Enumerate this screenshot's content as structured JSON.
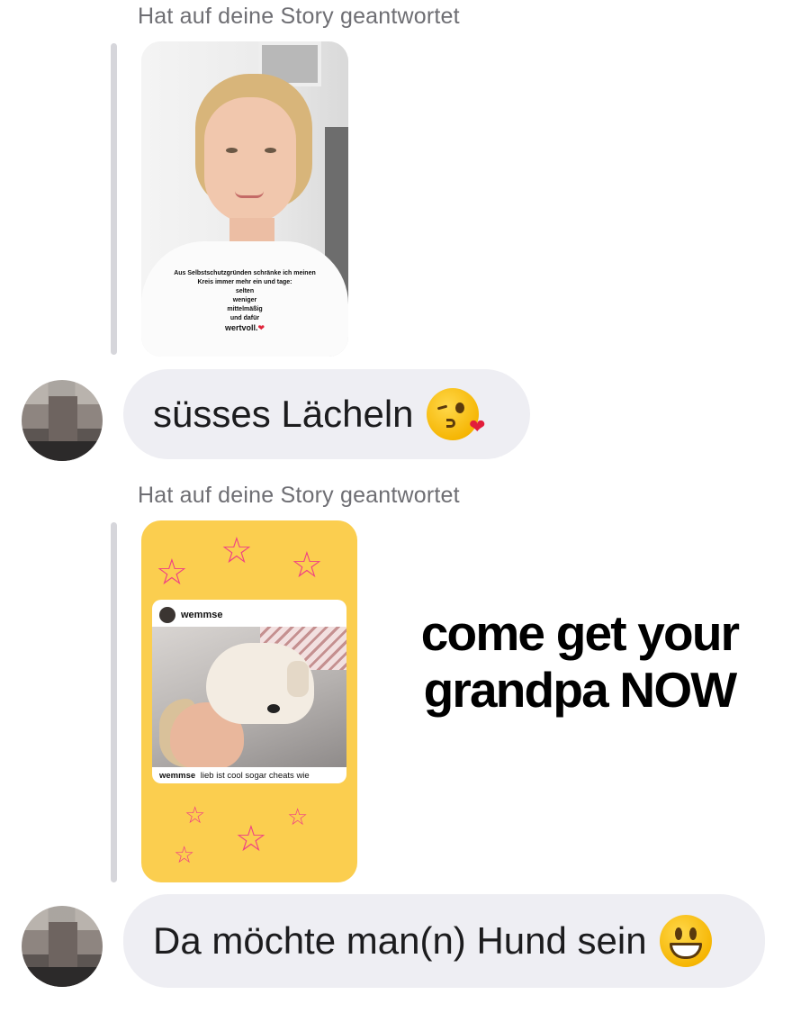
{
  "messages": [
    {
      "reply_label": "Hat auf deine Story geantwortet",
      "story": {
        "overlay_lines": [
          "Aus Selbstschutzgründen schränke ich meinen",
          "Kreis immer mehr ein und tage:",
          "selten",
          "weniger",
          "mittelmäßig",
          "und dafür"
        ],
        "overlay_last": "wertvoll.",
        "overlay_emoji": "heart"
      },
      "bubble_text": "süsses Lächeln",
      "bubble_emoji": "kissing-face-with-heart"
    },
    {
      "reply_label": "Hat auf deine Story geantwortet",
      "story": {
        "background_color": "#fbce4f",
        "decoration": "pink-star",
        "post_username": "wemmse",
        "post_caption_user": "wemmse",
        "post_caption_text": "lieb ist cool sogar cheats wie",
        "caption_line_1": "come get your",
        "caption_line_2": "grandpa NOW"
      },
      "bubble_text": "Da möchte man(n) Hund sein",
      "bubble_emoji": "grinning-face"
    }
  ],
  "colors": {
    "bubble_bg": "#eeeef3",
    "label_gray": "#6e6e73",
    "quote_bar": "#d6d6db",
    "star_pink": "#ef3f85"
  }
}
